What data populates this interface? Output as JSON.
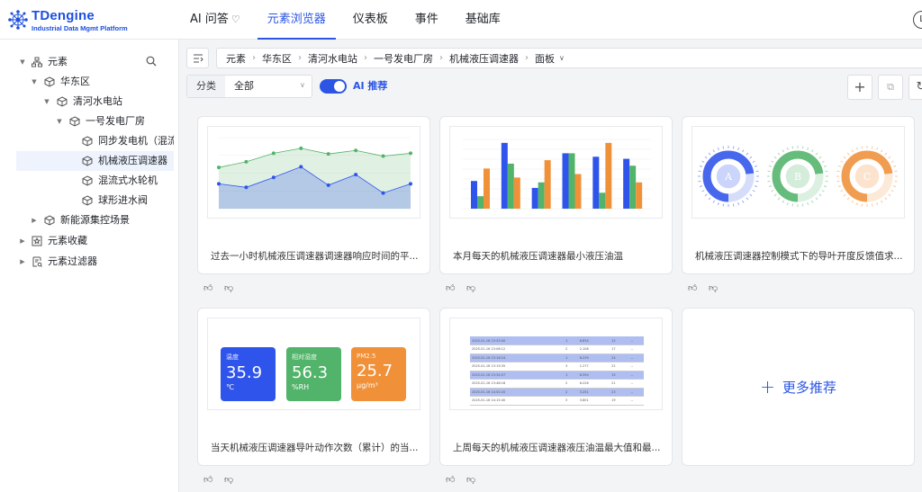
{
  "app": {
    "logo_title": "TDengine",
    "logo_subtitle": "Industrial Data Mgmt Platform",
    "brand_color": "#2c55e5"
  },
  "nav": {
    "items": [
      {
        "label": "AI 问答",
        "icon": "lightbulb-icon",
        "active": false
      },
      {
        "label": "元素浏览器",
        "active": true
      },
      {
        "label": "仪表板",
        "active": false
      },
      {
        "label": "事件",
        "active": false
      },
      {
        "label": "基础库",
        "active": false
      }
    ],
    "user_initial": "L"
  },
  "sidebar": {
    "tree": [
      {
        "label": "元素",
        "icon": "org-icon",
        "expanded": true
      },
      {
        "label": "华东区",
        "icon": "cube-icon",
        "expanded": true
      },
      {
        "label": "清河水电站",
        "icon": "cube-icon",
        "expanded": true
      },
      {
        "label": "一号发电厂房",
        "icon": "cube-icon",
        "expanded": true
      },
      {
        "label": "同步发电机（混流式",
        "icon": "cube-icon"
      },
      {
        "label": "机械液压调速器",
        "icon": "cube-icon",
        "selected": true
      },
      {
        "label": "混流式水轮机",
        "icon": "cube-icon"
      },
      {
        "label": "球形进水阀",
        "icon": "cube-icon"
      },
      {
        "label": "新能源集控场景",
        "icon": "cube-icon",
        "expanded": false
      },
      {
        "label": "元素收藏",
        "icon": "favorites-icon",
        "expanded": false
      },
      {
        "label": "元素过滤器",
        "icon": "filter-icon",
        "expanded": false
      }
    ]
  },
  "breadcrumb": {
    "items": [
      "元素",
      "华东区",
      "清河水电站",
      "一号发电厂房",
      "机械液压调速器",
      "面板"
    ]
  },
  "filter": {
    "label": "分类",
    "value": "全部",
    "ai_toggle_label": "AI 推荐",
    "ai_toggle_on": true
  },
  "cards": [
    {
      "caption": "过去一小时机械液压调速器调速器响应时间的平..."
    },
    {
      "caption": "本月每天的机械液压调速器最小液压油温"
    },
    {
      "caption": "机械液压调速器控制模式下的导叶开度反馈值求..."
    },
    {
      "caption": "当天机械液压调速器导叶动作次数（累计）的当..."
    },
    {
      "caption": "上周每天的机械液压调速器液压油温最大值和最..."
    }
  ],
  "more_card_label": "更多推荐",
  "metrics": [
    {
      "label": "温度",
      "value": "35.9",
      "unit": "℃",
      "color": "#2f54eb"
    },
    {
      "label": "相对湿度",
      "value": "56.3",
      "unit": "%RH",
      "color": "#52b36a"
    },
    {
      "label": "PM2.5",
      "value": "25.7",
      "unit": "μg/m³",
      "color": "#f0913a"
    }
  ],
  "gauges": [
    {
      "letter": "A",
      "color": "#2f54eb"
    },
    {
      "letter": "B",
      "color": "#52b36a"
    },
    {
      "letter": "C",
      "color": "#f0913a"
    }
  ],
  "mini_table_rows": [
    [
      "2025-01-16 13:25:00",
      "1",
      "6.834",
      "12",
      "--"
    ],
    [
      "2025-01-16 13:08:12",
      "2",
      "2.108",
      "17",
      "--"
    ],
    [
      "2025-01-16 13:16:24",
      "1",
      "6.239",
      "24",
      "--"
    ],
    [
      "2025-01-16 13:19:35",
      "3",
      "1.277",
      "22",
      "--"
    ],
    [
      "2025-01-16 13:34:57",
      "1",
      "6.394",
      "15",
      "--"
    ],
    [
      "2025-01-16 13:48:18",
      "2",
      "6.226",
      "21",
      "--"
    ],
    [
      "2025-01-16 14:02:20",
      "2",
      "3.251",
      "23",
      "--"
    ],
    [
      "2025-01-16 14:15:40",
      "3",
      "3.801",
      "19",
      "--"
    ]
  ],
  "chart_data": [
    {
      "type": "area",
      "series": [
        {
          "values": [
            58,
            66,
            78,
            85,
            77,
            82,
            74,
            78
          ],
          "color": "#52b36a"
        },
        {
          "values": [
            35,
            30,
            44,
            59,
            33,
            48,
            22,
            35
          ],
          "color": "#2f54eb"
        }
      ],
      "ylim": [
        0,
        100
      ]
    },
    {
      "type": "bar",
      "series": [
        {
          "values": [
            40,
            95,
            30,
            80,
            75,
            72
          ],
          "color": "#2f54eb"
        },
        {
          "values": [
            18,
            65,
            38,
            80,
            23,
            62
          ],
          "color": "#52b36a"
        },
        {
          "values": [
            58,
            45,
            70,
            50,
            95,
            38
          ],
          "color": "#f0913a"
        }
      ],
      "ylim": [
        0,
        100
      ]
    }
  ]
}
